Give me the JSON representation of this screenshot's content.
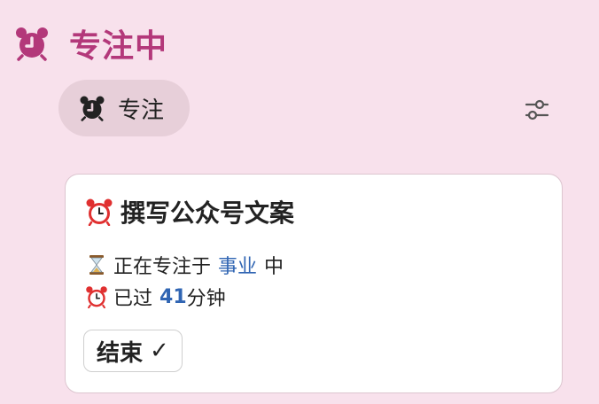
{
  "header": {
    "title": "专注中",
    "icon": "alarm-clock-icon",
    "accent": "#b3387a"
  },
  "tab": {
    "label": "专注",
    "icon": "alarm-clock-icon"
  },
  "settings": {
    "icon": "sliders-icon"
  },
  "card": {
    "title": "撰写公众号文案",
    "title_icon": "alarm-clock-emoji",
    "status_prefix": "正在专注于",
    "status_category": "事业",
    "status_suffix": "中",
    "status_icon": "hourglass-emoji",
    "elapsed_prefix": "已过",
    "elapsed_minutes": "41",
    "elapsed_unit": "分钟",
    "elapsed_icon": "alarm-clock-emoji",
    "end_button_label": "结束",
    "end_button_check": "✓",
    "link_color": "#3065b3"
  }
}
